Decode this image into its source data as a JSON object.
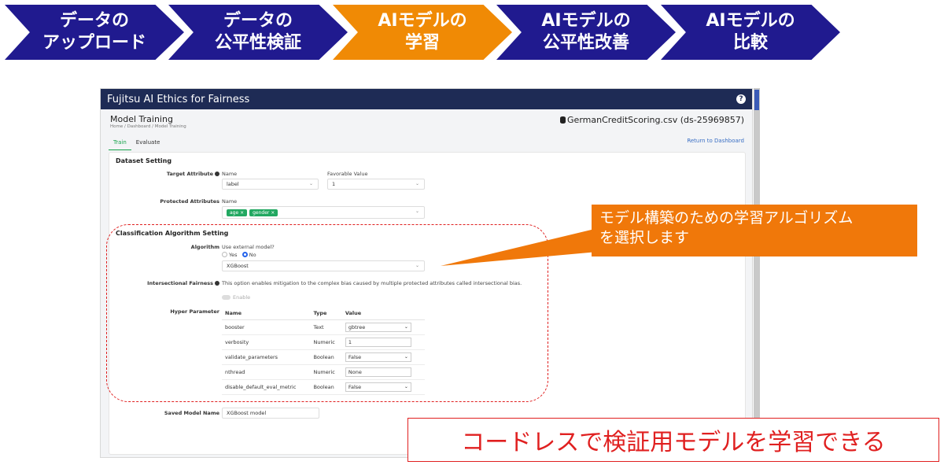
{
  "steps": [
    {
      "line1": "データの",
      "line2": "アップロード",
      "color": "#201a8f"
    },
    {
      "line1": "データの",
      "line2": "公平性検証",
      "color": "#201a8f"
    },
    {
      "line1": "AIモデルの",
      "line2": "学習",
      "color": "#f08a05"
    },
    {
      "line1": "AIモデルの",
      "line2": "公平性改善",
      "color": "#201a8f"
    },
    {
      "line1": "AIモデルの",
      "line2": "比較",
      "color": "#201a8f"
    }
  ],
  "app": {
    "title": "Fujitsu AI Ethics for Fairness",
    "help_icon": "?",
    "page_title": "Model Training",
    "breadcrumb": "Home  /  Dashboard  /  Model Training",
    "dataset": "GermanCreditScoring.csv (ds-25969857)",
    "tabs": [
      "Train",
      "Evaluate"
    ],
    "return_link": "Return to Dashboard"
  },
  "dataset_setting": {
    "title": "Dataset Setting",
    "target_label": "Target Attribute",
    "name_label": "Name",
    "name_value": "label",
    "favorable_label": "Favorable Value",
    "favorable_value": "1",
    "protected_label": "Protected Attributes",
    "protected_name_label": "Name",
    "protected_tags": [
      "age ×",
      "gender ×"
    ]
  },
  "algo_setting": {
    "title": "Classification Algorithm Setting",
    "algorithm_label": "Algorithm",
    "external_question": "Use external model?",
    "yes": "Yes",
    "no": "No",
    "algorithm_value": "XGBoost",
    "intersectional_label": "Intersectional Fairness",
    "intersectional_desc": "This option enables mitigation to the complex bias caused by multiple protected attributes called intersectional bias.",
    "enable_label": "Enable",
    "hyper_label": "Hyper Parameter",
    "hyper_headers": [
      "Name",
      "Type",
      "Value"
    ],
    "hyper_rows": [
      {
        "name": "booster",
        "type": "Text",
        "value": "gbtree",
        "select": true
      },
      {
        "name": "verbosity",
        "type": "Numeric",
        "value": "1",
        "select": false
      },
      {
        "name": "validate_parameters",
        "type": "Boolean",
        "value": "False",
        "select": true
      },
      {
        "name": "nthread",
        "type": "Numeric",
        "value": "None",
        "select": false
      },
      {
        "name": "disable_default_eval_metric",
        "type": "Boolean",
        "value": "False",
        "select": true
      }
    ],
    "saved_model_label": "Saved Model Name",
    "saved_model_value": "XGBoost model"
  },
  "callout": {
    "line1": "モデル構築のための学習アルゴリズム",
    "line2": "を選択します"
  },
  "banner": "コードレスで検証用モデルを学習できる",
  "colors": {
    "accent": "#f08a05",
    "step": "#201a8f",
    "highlight": "#e02020",
    "tag": "#22a861"
  }
}
